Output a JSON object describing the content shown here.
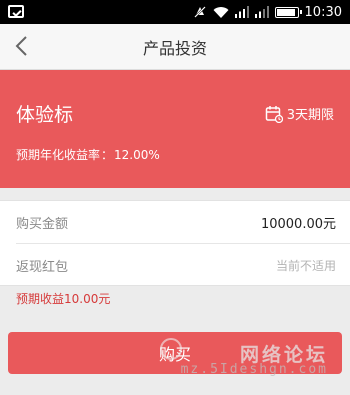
{
  "status_bar": {
    "time": "10:30"
  },
  "nav": {
    "title": "产品投资"
  },
  "product": {
    "name": "体验标",
    "period": "3天期限",
    "rate_label": "预期年化收益率",
    "rate_sep": "：",
    "rate_value": "12.00%"
  },
  "form": {
    "rows": [
      {
        "label": "购买金额",
        "value": "10000.00元"
      },
      {
        "label": "返现红包",
        "value": "当前不适用"
      }
    ],
    "expected_income": "预期收益10.00元"
  },
  "actions": {
    "buy_label": "购买"
  },
  "watermark": {
    "text_cn": "网络论坛",
    "text_url": "mz.5Ideshgn.com"
  },
  "colors": {
    "accent": "#e9595b",
    "expected_text": "#d63a3a"
  }
}
